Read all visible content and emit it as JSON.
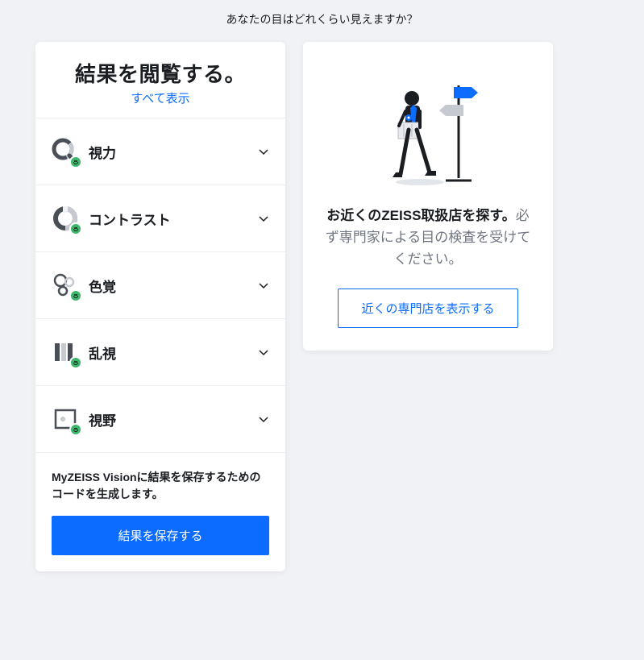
{
  "page_title": "あなたの目はどれくらい見えますか？",
  "results": {
    "title": "結果を閲覧する。",
    "show_all_label": "すべて表示",
    "items": [
      {
        "icon": "acuity-icon",
        "label": "視力",
        "status": "good"
      },
      {
        "icon": "contrast-icon",
        "label": "コントラスト",
        "status": "good"
      },
      {
        "icon": "color-icon",
        "label": "色覚",
        "status": "good"
      },
      {
        "icon": "astigmatism-icon",
        "label": "乱視",
        "status": "good"
      },
      {
        "icon": "field-icon",
        "label": "視野",
        "status": "good"
      }
    ],
    "save_description": "MyZEISS Visionに結果を保存するためのコードを生成します。",
    "save_button_label": "結果を保存する"
  },
  "cta": {
    "illustration": "person-signpost-illustration",
    "heading_bold": "お近くのZEISS取扱店を探す。",
    "body_rest": "必ず専門家による目の検査を受けてください。",
    "button_label": "近くの専門店を表示する"
  },
  "colors": {
    "primary": "#0b6cff",
    "success": "#3bb66a",
    "text": "#1a1d21",
    "muted": "#707682",
    "bg": "#f0f2f5",
    "card": "#ffffff"
  }
}
